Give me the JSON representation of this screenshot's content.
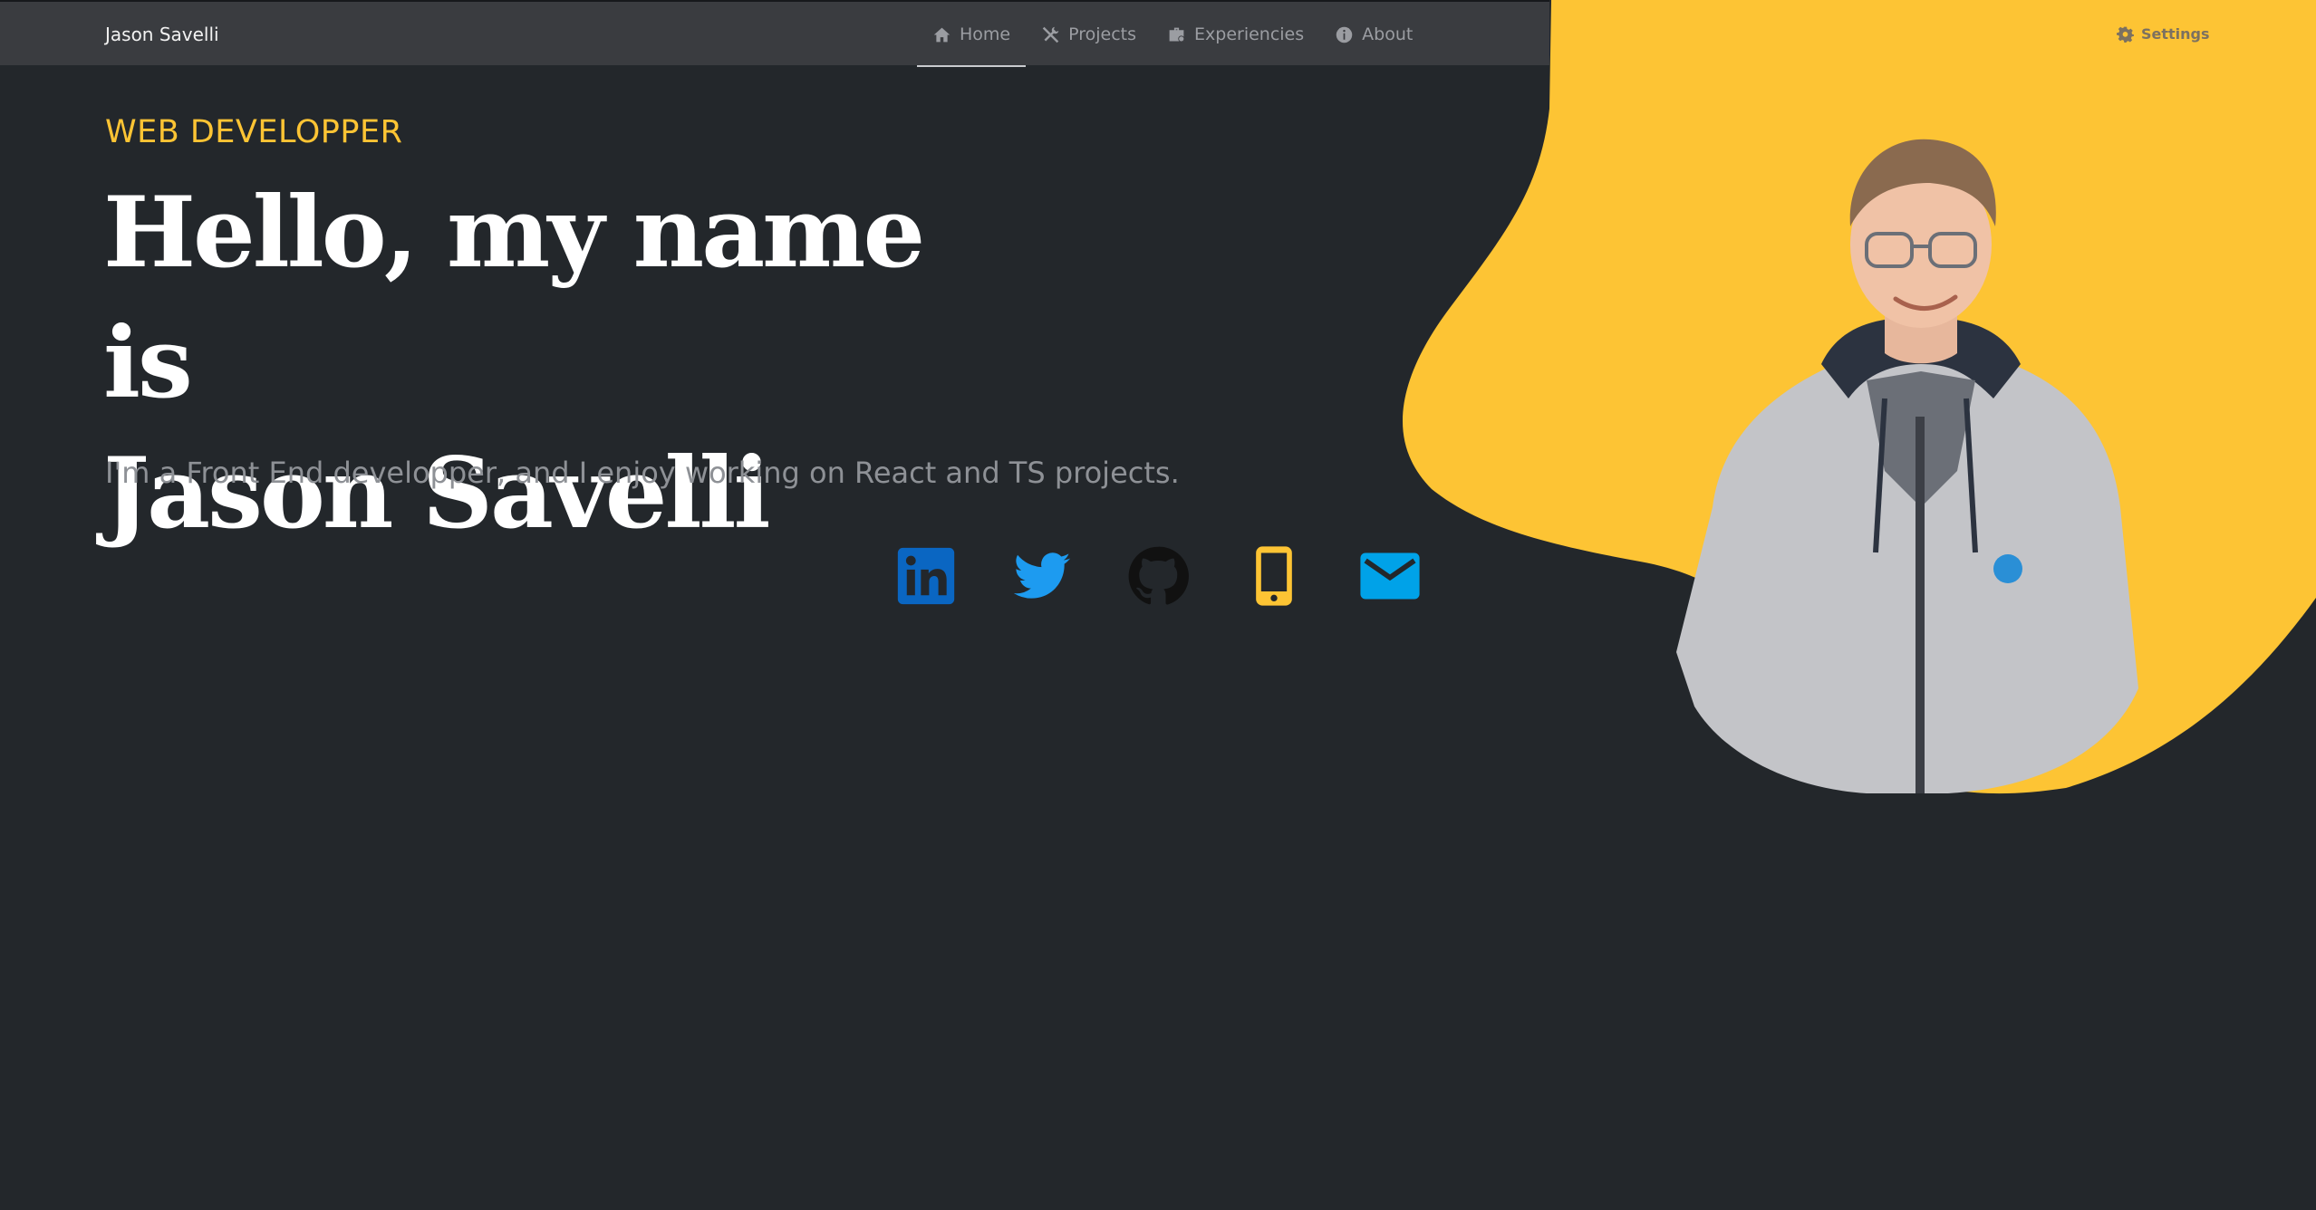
{
  "colors": {
    "accent": "#fdc434",
    "background": "#23272b",
    "navbar": "#3a3c40",
    "linkedin": "#0a66c2",
    "twitter": "#1d9bf0",
    "github": "#111111",
    "phone": "#fdc434",
    "mail": "#00a2e8"
  },
  "navbar": {
    "brand": "Jason Savelli",
    "items": [
      {
        "label": "Home",
        "icon": "home-icon",
        "active": true
      },
      {
        "label": "Projects",
        "icon": "tools-icon",
        "active": false
      },
      {
        "label": "Experiencies",
        "icon": "briefcase-icon",
        "active": false
      },
      {
        "label": "About",
        "icon": "info-icon",
        "active": false
      }
    ],
    "settings_label": "Settings"
  },
  "hero": {
    "eyebrow": "WEB DEVELOPPER",
    "title_line1": "Hello, my name is",
    "title_line2": "Jason Savelli",
    "subtitle": "I'm a Front End developper, and I enjoy working on React and TS projects."
  },
  "socials": [
    {
      "name": "LinkedIn",
      "icon": "linkedin-icon"
    },
    {
      "name": "Twitter",
      "icon": "twitter-icon"
    },
    {
      "name": "GitHub",
      "icon": "github-icon"
    },
    {
      "name": "Phone",
      "icon": "phone-icon"
    },
    {
      "name": "Mail",
      "icon": "mail-icon"
    }
  ]
}
